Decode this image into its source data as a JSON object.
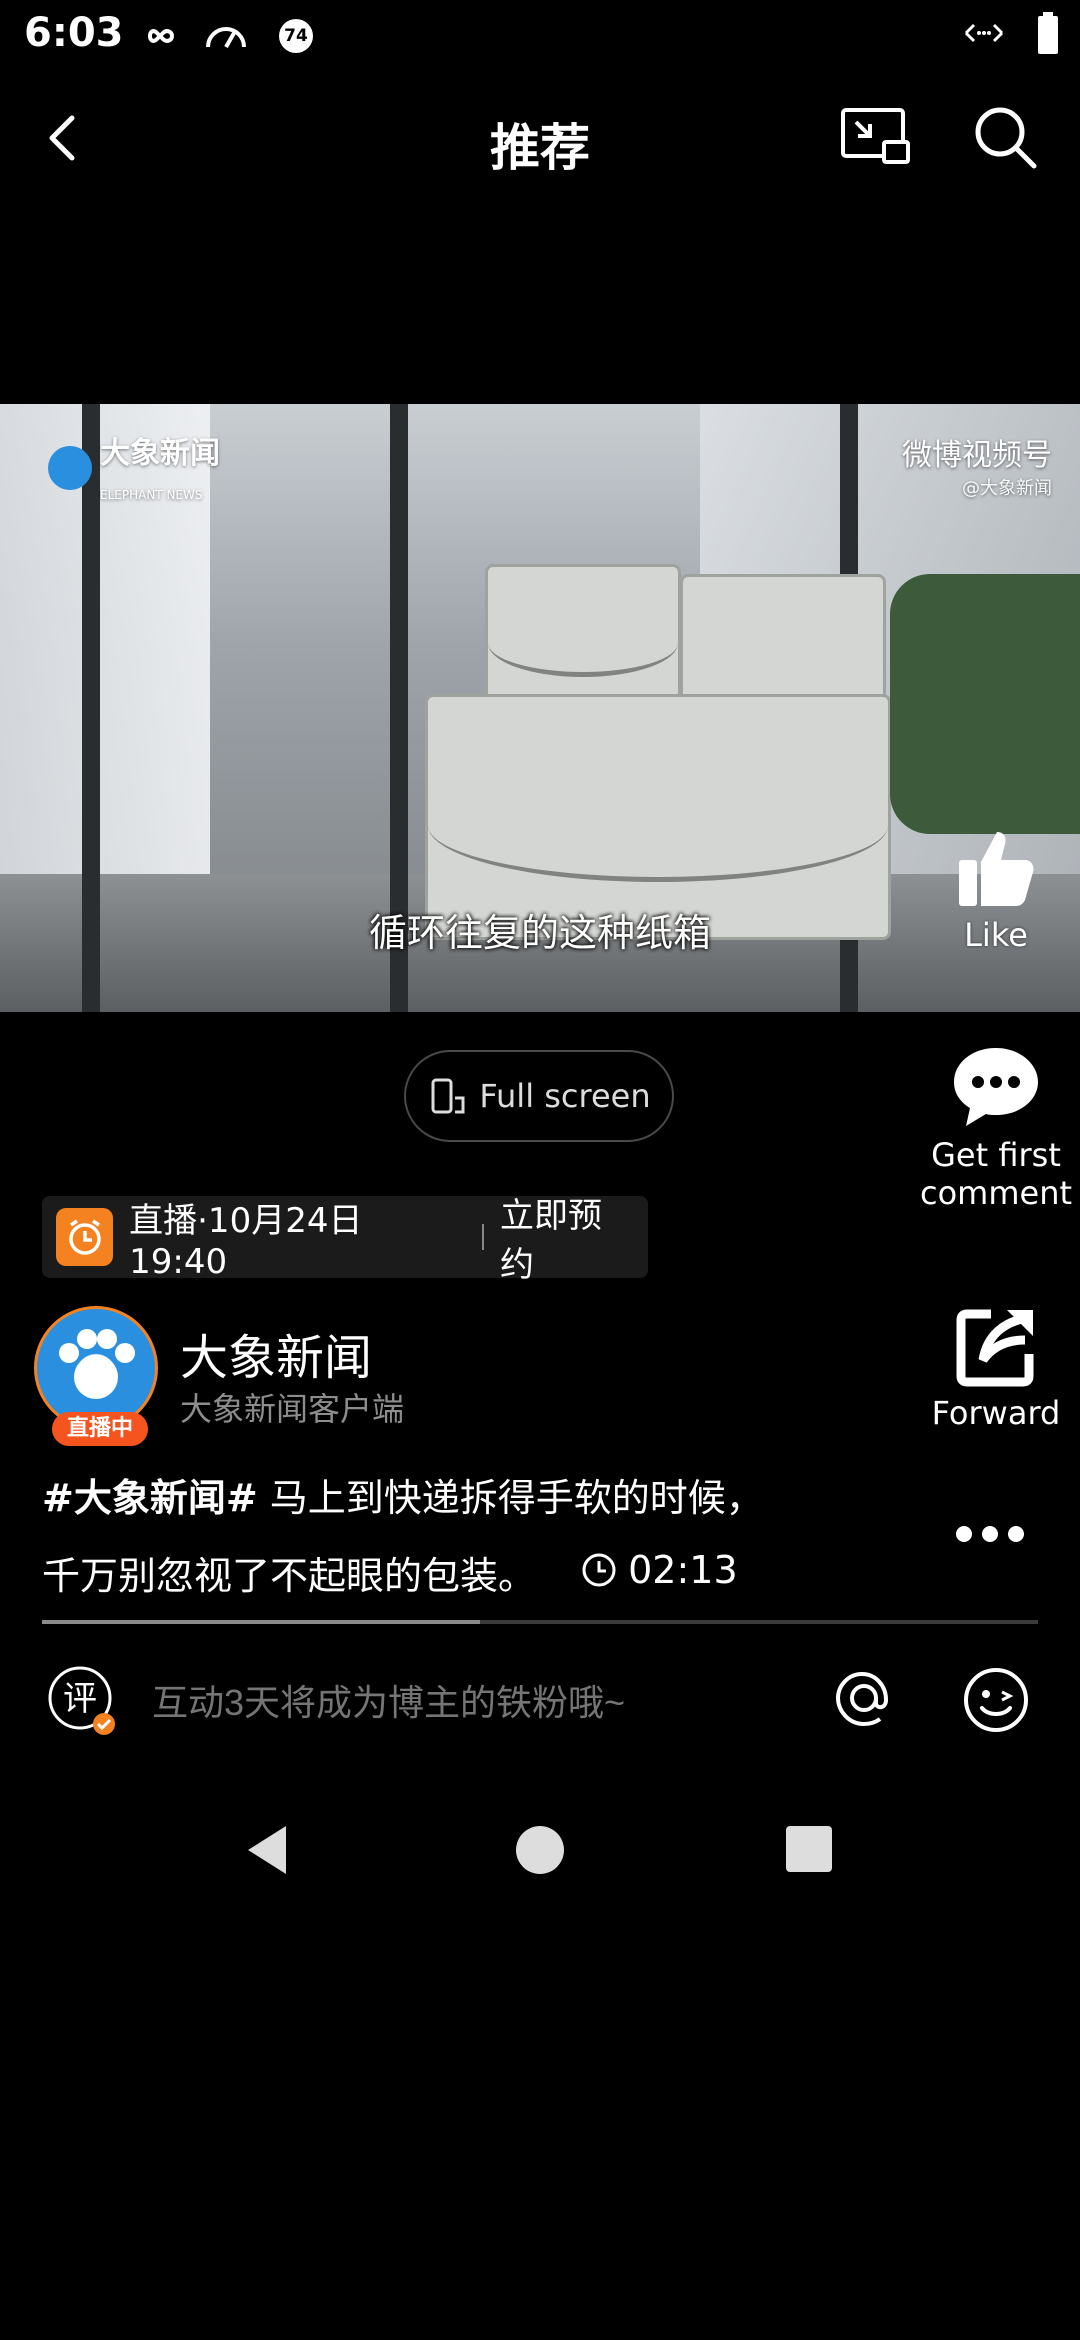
{
  "status_bar": {
    "time": "6:03",
    "left_icons": [
      "infinity-icon",
      "speedometer-icon",
      "notification-74-icon"
    ],
    "notification_count": "74",
    "right_icons": [
      "data-arrows-icon",
      "battery-icon"
    ]
  },
  "header": {
    "title": "推荐",
    "back_icon": "chevron-left-icon",
    "pip_icon": "picture-in-picture-icon",
    "search_icon": "search-icon"
  },
  "video": {
    "watermark_left": "大象新闻",
    "watermark_left_sub": "ELEPHANT NEWS",
    "watermark_right": "微博视频号",
    "watermark_right_sub": "@大象新闻",
    "subtitle": "循环往复的这种纸箱"
  },
  "actions": {
    "like_label": "Like",
    "comment_label_line1": "Get first",
    "comment_label_line2": "comment",
    "forward_label": "Forward"
  },
  "fullscreen": {
    "label": "Full screen"
  },
  "live": {
    "text": "直播·10月24日 19:40",
    "cta": "立即预约"
  },
  "author": {
    "name": "大象新闻",
    "subtitle": "大象新闻客户端",
    "live_badge": "直播中"
  },
  "caption": {
    "tag": "#大象新闻#",
    "line1": " 马上到快递拆得手软的时候，",
    "line2": "千万别忽视了不起眼的包装。",
    "duration": "02:13"
  },
  "progress": {
    "fraction": 0.44
  },
  "comment_bar": {
    "comment_icon_char": "评",
    "placeholder": "互动3天将成为博主的铁粉哦~"
  },
  "colors": {
    "accent_orange": "#f58220",
    "live_red": "#f5541f",
    "background": "#000000"
  }
}
